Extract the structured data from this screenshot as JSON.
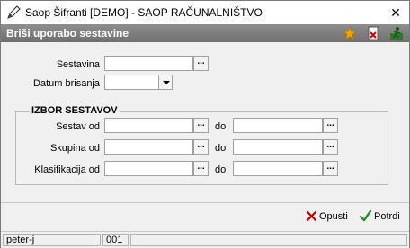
{
  "window": {
    "title": "Saop Šifranti [DEMO] - SAOP RAČUNALNIŠTVO",
    "close_glyph": "✕"
  },
  "header": {
    "title": "Briši uporabo sestavine",
    "icons": [
      "star-icon",
      "document-delete-icon",
      "exit-run-icon"
    ]
  },
  "form": {
    "sestavina_label": "Sestavina",
    "sestavina_value": "",
    "datum_label": "Datum brisanja",
    "datum_value": "",
    "lookup_glyph": "..."
  },
  "group": {
    "title": "IZBOR SESTAVOV",
    "do_label": "do",
    "rows": [
      {
        "label": "Sestav od",
        "from": "",
        "to": ""
      },
      {
        "label": "Skupina od",
        "from": "",
        "to": ""
      },
      {
        "label": "Klasifikacija od",
        "from": "",
        "to": ""
      }
    ]
  },
  "buttons": {
    "cancel_label": "Opusti",
    "confirm_label": "Potrdi"
  },
  "status": {
    "user": "peter-j",
    "code": "001",
    "extra": ""
  },
  "colors": {
    "header_bg": "#7f7f7f",
    "cancel_x": "#c00000",
    "confirm_check": "#2e8b2e",
    "star": "#f0a800"
  }
}
